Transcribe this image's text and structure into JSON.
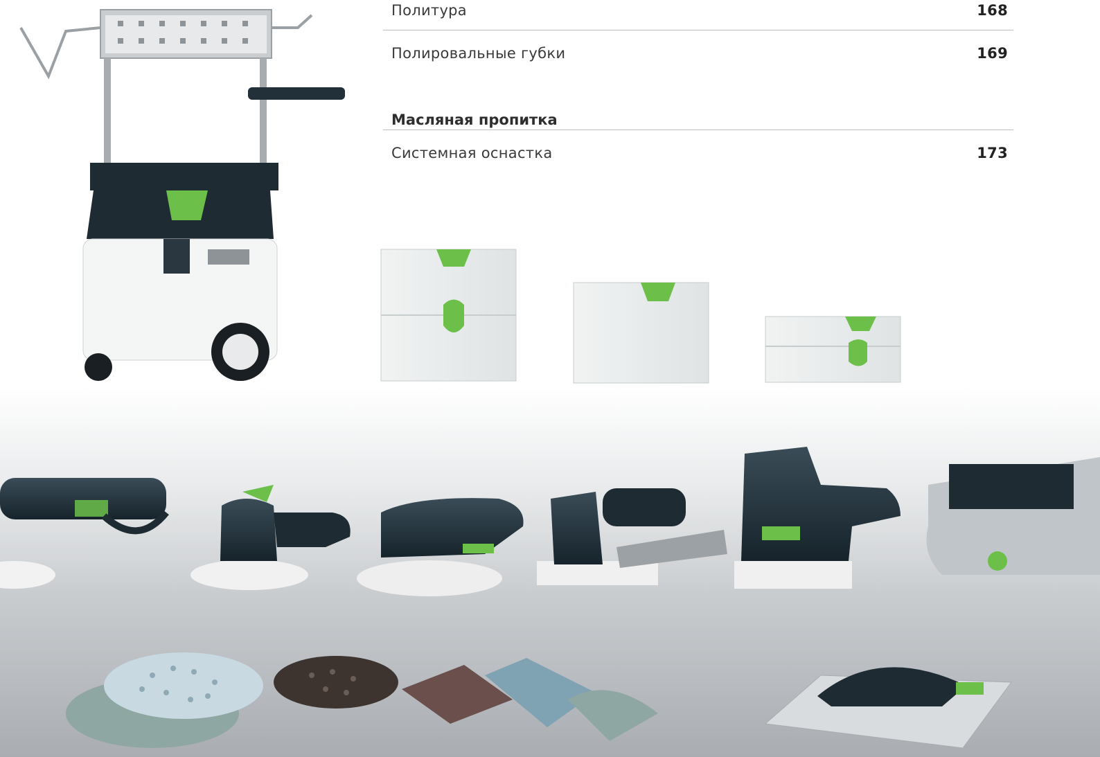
{
  "toc": {
    "items": [
      {
        "label": "Политура",
        "page": "168"
      },
      {
        "label": "Полировальные губки",
        "page": "169"
      }
    ],
    "section": {
      "heading": "Масляная пропитка",
      "items": [
        {
          "label": "Системная оснастка",
          "page": "173"
        }
      ]
    }
  },
  "brand": {
    "accent_green": "#6cc04a",
    "tool_dark": "#1f2b33"
  },
  "illustration": {
    "subjects": [
      "vacuum-cart",
      "systainer-cases",
      "sanders",
      "sanding-discs",
      "hand-sanding-block"
    ]
  }
}
